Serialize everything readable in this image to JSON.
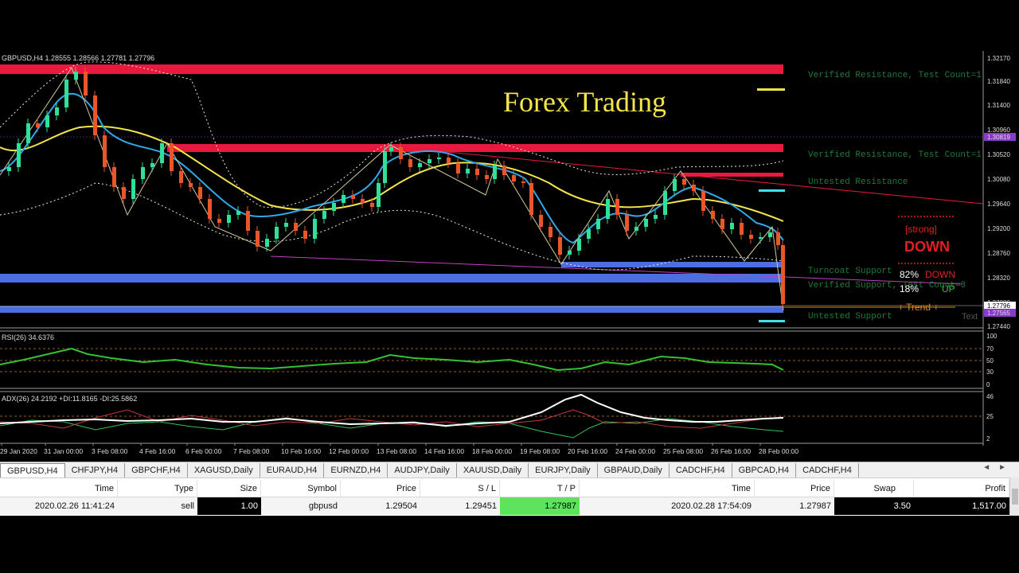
{
  "chart": {
    "header": "GBPUSD,H4  1.28555 1.28566 1.27781 1.27796",
    "title": "Forex Trading",
    "time_labels": [
      "29 Jan 2020",
      "31 Jan 00:00",
      "3 Feb 08:00",
      "4 Feb 16:00",
      "6 Feb 00:00",
      "7 Feb 08:00",
      "10 Feb 16:00",
      "12 Feb 00:00",
      "13 Feb 08:00",
      "14 Feb 16:00",
      "18 Feb 00:00",
      "19 Feb 08:00",
      "20 Feb 16:00",
      "24 Feb 00:00",
      "25 Feb 08:00",
      "26 Feb 16:00",
      "28 Feb 00:00"
    ],
    "price_labels": [
      "1.32170",
      "1.31840",
      "1.31400",
      "1.30960",
      "1.30819",
      "1.30520",
      "1.30080",
      "1.29640",
      "1.29200",
      "1.28760",
      "1.28320",
      "1.27880",
      "1.27796",
      "1.27565",
      "1.27440"
    ],
    "zones": {
      "res1": "Verified Resistance, Test Count=1",
      "res2": "Verified Resistance, Test Count=1",
      "res3": "Untested Resistance",
      "sup1": "Turncoat Support",
      "sup2": "Verified Support, Test Count=3",
      "sup3": "Untested Support"
    },
    "signal": {
      "strength": "[strong]",
      "direction": "DOWN",
      "down_pct": "82%",
      "down_label": "DOWN",
      "up_pct": "18%",
      "up_label": "UP",
      "trend": "+ Trend +",
      "text_tag": "Text"
    },
    "rsi": {
      "label": "RSI(26) 34.6376",
      "levels": [
        "70",
        "50",
        "30",
        "100",
        "0"
      ]
    },
    "adx": {
      "label": "ADX(26) 24.2192 +DI:11.8165 -DI:25.5862",
      "levels": [
        "46",
        "25",
        "2"
      ]
    },
    "colors": {
      "resistance": "#e8193c",
      "support": "#4b6fe0",
      "bullish": "#2fe09a",
      "bearish": "#e8562a",
      "ma_yellow": "#f5e54a",
      "ma_blue": "#2fa8e8",
      "zone_text": "#1f7a3a",
      "rsi_line": "#34c234"
    }
  },
  "tabs": [
    "GBPUSD,H4",
    "CHFJPY,H4",
    "GBPCHF,H4",
    "XAGUSD,Daily",
    "EURAUD,H4",
    "EURNZD,H4",
    "AUDJPY,Daily",
    "XAUUSD,Daily",
    "EURJPY,Daily",
    "GBPAUD,Daily",
    "CADCHF,H4",
    "GBPCAD,H4",
    "CADCHF,H4"
  ],
  "active_tab": "GBPUSD,H4",
  "trade_table": {
    "headers": {
      "time": "Time",
      "type": "Type",
      "size": "Size",
      "symbol": "Symbol",
      "price": "Price",
      "sl": "S / L",
      "tp": "T / P",
      "close_time": "Time",
      "close_price": "Price",
      "swap": "Swap",
      "profit": "Profit"
    },
    "row": {
      "time": "2020.02.26 11:41:24",
      "type": "sell",
      "size": "1.00",
      "symbol": "gbpusd",
      "price": "1.29504",
      "sl": "1.29451",
      "tp": "1.27987",
      "close_time": "2020.02.28 17:54:09",
      "close_price": "1.27987",
      "swap": "3.50",
      "profit": "1,517.00"
    }
  }
}
